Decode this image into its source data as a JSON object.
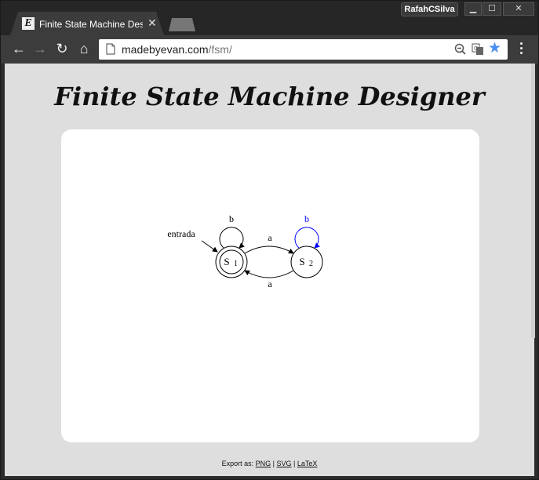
{
  "browser": {
    "profile_name": "RafahCSilva",
    "tab": {
      "title": "Finite State Machine Designer",
      "favicon_letter": "E"
    },
    "address": {
      "domain": "madebyevan.com",
      "path": "/fsm/"
    }
  },
  "page": {
    "title": "Finite State Machine Designer",
    "export_label": "Export as:",
    "export_links": [
      "PNG",
      "SVG",
      "LaTeX"
    ],
    "separator": "|"
  },
  "fsm": {
    "states": [
      {
        "name": "S",
        "subscript": "1",
        "accepting": true
      },
      {
        "name": "S",
        "subscript": "2",
        "accepting": false
      }
    ],
    "start_arrow_label": "entrada",
    "transitions": [
      {
        "from": "S1",
        "to": "S1",
        "label": "b",
        "selected": false
      },
      {
        "from": "S1",
        "to": "S2",
        "label": "a",
        "selected": false
      },
      {
        "from": "S2",
        "to": "S1",
        "label": "a",
        "selected": false
      },
      {
        "from": "S2",
        "to": "S2",
        "label": "b",
        "selected": true
      }
    ],
    "colors": {
      "default": "#000000",
      "selected": "#0000ff"
    }
  }
}
